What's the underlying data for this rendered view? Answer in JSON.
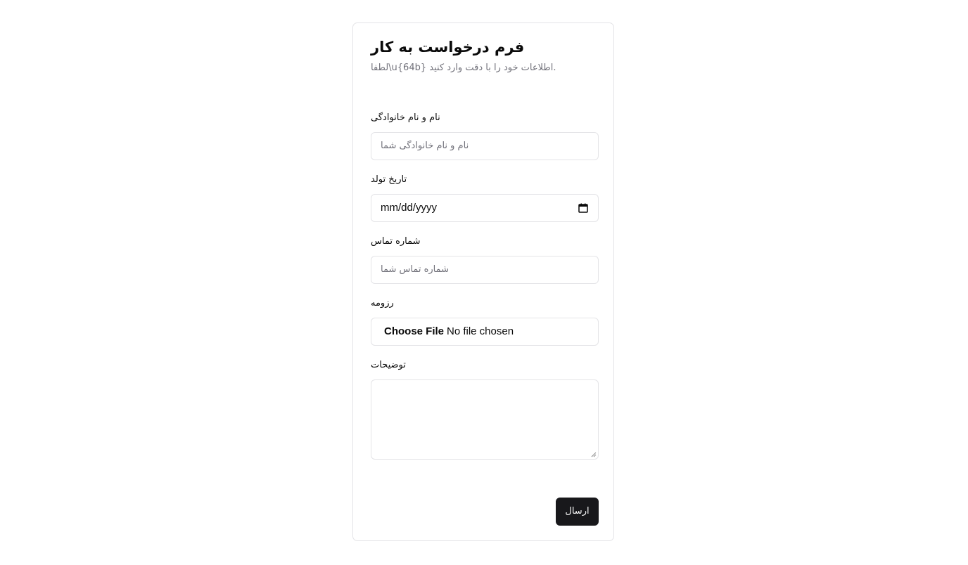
{
  "form": {
    "title": "فرم درخواست به کار",
    "subtitle": "لطفا\\u{64b} اطلاعات خود را با دقت وارد کنید.",
    "fields": {
      "full_name": {
        "label": "نام و نام خانوادگی",
        "placeholder": "نام و نام خانوادگی شما"
      },
      "birth_date": {
        "label": "تاریخ تولد",
        "value": "mm/dd/yyyy",
        "icon": "calendar-icon"
      },
      "phone": {
        "label": "شماره تماس",
        "placeholder": "شماره تماس شما"
      },
      "resume": {
        "label": "رزومه",
        "button_label": "Choose File",
        "status": "No file chosen"
      },
      "description": {
        "label": "توضیحات",
        "value": ""
      }
    },
    "submit_label": "ارسال"
  },
  "colors": {
    "border": "#e4e4e7",
    "muted_text": "#71717a",
    "primary": "#18181b",
    "primary_text": "#fafafa"
  }
}
